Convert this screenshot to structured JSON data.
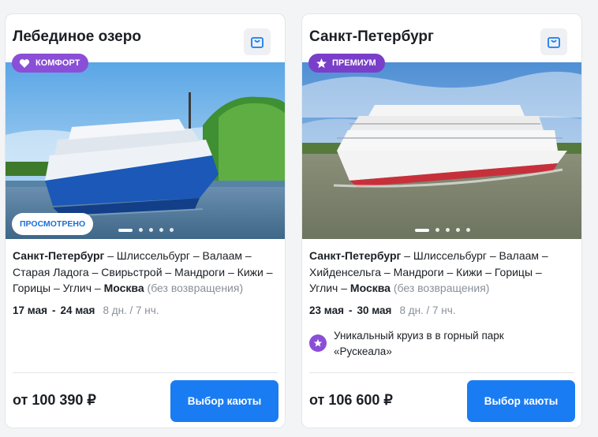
{
  "cards": [
    {
      "title": "Лебединое озеро",
      "badge": {
        "label": "КОМФОРТ",
        "icon": "heart-icon"
      },
      "viewed_label": "ПРОСМОТРЕНО",
      "route": {
        "start": "Санкт-Петербург",
        "middle": " – Шлиссельбург – Валаам – Старая Ладога – Свирьстрой – Мандроги – Кижи – Горицы – Углич – ",
        "end": "Москва",
        "note": "(без возвращения)"
      },
      "dates": {
        "from": "17 мая",
        "sep": "-",
        "to": "24 мая",
        "duration": "8 дн. / 7 нч."
      },
      "price": "от 100 390 ₽",
      "button_label": "Выбор каюты"
    },
    {
      "title": "Санкт-Петербург",
      "badge": {
        "label": "ПРЕМИУМ",
        "icon": "star-icon"
      },
      "route": {
        "start": "Санкт-Петербург",
        "middle": " – Шлиссельбург – Валаам – Хийденсельга – Мандроги – Кижи – Горицы – Углич – ",
        "end": "Москва",
        "note": "(без возвращения)"
      },
      "dates": {
        "from": "23 мая",
        "sep": "-",
        "to": "30 мая",
        "duration": "8 дн. / 7 нч."
      },
      "feature": "Уникальный круиз в в горный парк «Рускеала»",
      "price": "от 106 600 ₽",
      "button_label": "Выбор каюты"
    }
  ],
  "colors": {
    "accent": "#1a7cf2",
    "badge_purple": "#8a4fd6"
  }
}
